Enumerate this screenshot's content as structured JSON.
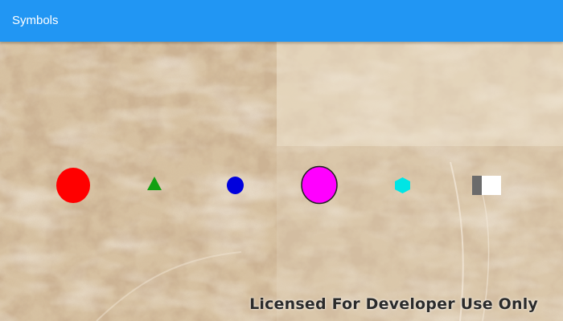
{
  "app_bar": {
    "title": "Symbols",
    "color": "#2196f3"
  },
  "map": {
    "basemap": "satellite-imagery",
    "attribution": "Licensed For Developer Use Only"
  },
  "symbols": [
    {
      "shape": "circle",
      "color": "#ff0000"
    },
    {
      "shape": "triangle",
      "color": "#12a012"
    },
    {
      "shape": "circle",
      "color": "#0000dd"
    },
    {
      "shape": "circle-with-outline",
      "color": "#ff00ff",
      "outline": "#222222"
    },
    {
      "shape": "hexagon",
      "color": "#00e5e5"
    },
    {
      "shape": "square-composite",
      "colors": [
        "#6b6b6b",
        "#ffffff"
      ]
    }
  ]
}
